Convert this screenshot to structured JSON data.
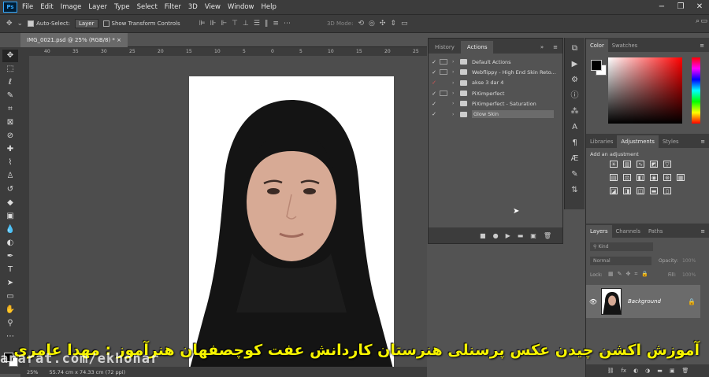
{
  "app": {
    "logo": "Ps"
  },
  "menu": [
    "File",
    "Edit",
    "Image",
    "Layer",
    "Type",
    "Select",
    "Filter",
    "3D",
    "View",
    "Window",
    "Help"
  ],
  "window_controls": [
    "−",
    "❐",
    "✕"
  ],
  "options_bar": {
    "auto_select_label": "Auto-Select:",
    "auto_select_value": "Layer",
    "transform_label": "Show Transform Controls",
    "mode_3d": "3D Mode:"
  },
  "document": {
    "tab_title": "IMG_0021.psd @ 25% (RGB/8) *",
    "ruler_ticks": [
      "40",
      "35",
      "30",
      "25",
      "20",
      "15",
      "10",
      "5",
      "0",
      "5",
      "10",
      "15",
      "20",
      "25"
    ],
    "zoom": "25%",
    "doc_size": "55.74 cm x 74.33 cm (72 ppi)"
  },
  "actions_panel": {
    "tabs": [
      "History",
      "Actions"
    ],
    "active_tab": "Actions",
    "items": [
      {
        "name": "Default Actions",
        "checked": "✓"
      },
      {
        "name": "Webflippy - High End Skin Reto...",
        "checked": "✓"
      },
      {
        "name": "akse 3 dar 4",
        "checked": "✓"
      },
      {
        "name": "PiXimperfect",
        "checked": "✓"
      },
      {
        "name": "PiXimperfect - Saturation",
        "checked": "✓"
      },
      {
        "name": "Glow Skin",
        "checked": "✓"
      }
    ],
    "footer_icons": [
      "■",
      "●",
      "▶",
      "▬",
      "▣",
      "🗑"
    ]
  },
  "color_panel": {
    "tabs": [
      "Color",
      "Swatches"
    ],
    "active_tab": "Color",
    "fg": "#000000",
    "bg": "#ffffff",
    "accent": "#ff0000"
  },
  "adjustments_panel": {
    "tabs": [
      "Libraries",
      "Adjustments",
      "Styles"
    ],
    "active_tab": "Adjustments",
    "add_label": "Add an adjustment"
  },
  "layers_panel": {
    "tabs": [
      "Layers",
      "Channels",
      "Paths"
    ],
    "active_tab": "Layers",
    "filter_placeholder": "Kind",
    "blend_mode": "Normal",
    "opacity_label": "Opacity:",
    "opacity_value": "100%",
    "lock_label": "Lock:",
    "fill_label": "Fill:",
    "fill_value": "100%",
    "layer_name": "Background",
    "footer_icons": [
      "⛓",
      "fx",
      "◐",
      "◑",
      "▬",
      "▣",
      "🗑"
    ]
  },
  "overlay": {
    "subtitle": "آموزش اکشن چیدن عکس پرسنلی هنرستان کاردانش عفت کوچصفهان   هنرآموز : مهدا عامری",
    "watermark": "aparat.com/ekhonar"
  }
}
